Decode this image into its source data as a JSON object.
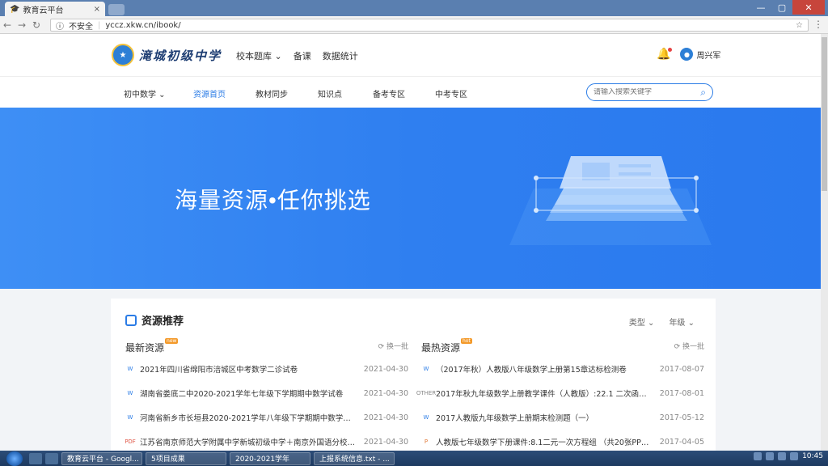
{
  "browser": {
    "tab_title": "教育云平台",
    "tab_close": "×",
    "insecure_label": "不安全",
    "url": "yccz.xkw.cn/ibook/",
    "win_min": "—",
    "win_max": "▢",
    "win_close": "✕"
  },
  "header": {
    "logo_text": "滝城初级中学",
    "nav": [
      "校本题库 ⌄",
      "备课",
      "数据统计"
    ],
    "user_name": "周兴军"
  },
  "subnav": {
    "items": [
      "初中数学 ⌄",
      "资源首页",
      "教材同步",
      "知识点",
      "备考专区",
      "中考专区"
    ],
    "active_index": 1,
    "search_placeholder": "请输入搜索关键字"
  },
  "banner": {
    "slogan": "海量资源•任你挑选"
  },
  "recommend": {
    "title": "资源推荐",
    "filters": [
      "类型 ⌄",
      "年级 ⌄"
    ],
    "latest": {
      "heading": "最新资源",
      "badge": "new",
      "refresh": "换一批",
      "rows": [
        {
          "type": "W",
          "title": "2021年四川省绵阳市涪城区中考数学二诊试卷",
          "date": "2021-04-30"
        },
        {
          "type": "W",
          "title": "湖南省娄底二中2020-2021学年七年级下学期期中数学试卷",
          "date": "2021-04-30"
        },
        {
          "type": "W",
          "title": "河南省新乡市长垣县2020-2021学年八年级下学期期中数学试卷",
          "date": "2021-04-30"
        },
        {
          "type": "PDF",
          "title": "江苏省南京师范大学附属中学新城初级中学＋南京外国语分校202...",
          "date": "2021-04-30"
        }
      ]
    },
    "hottest": {
      "heading": "最热资源",
      "badge": "hot",
      "refresh": "换一批",
      "rows": [
        {
          "type": "W",
          "title": "（2017年秋）人教版八年级数学上册第15章达标检测卷",
          "date": "2017-08-07"
        },
        {
          "type": "OTHER",
          "title": "2017年秋九年级数学上册教学课件（人教版）:22.1 二次函数的图...",
          "date": "2017-08-01"
        },
        {
          "type": "W",
          "title": "2017人教版九年级数学上册期末检测题（一）",
          "date": "2017-05-12"
        },
        {
          "type": "P",
          "title": "人教版七年级数学下册课件:8.1二元一次方程组 （共20张PPT）",
          "date": "2017-04-05"
        }
      ]
    }
  },
  "taskbar": {
    "items": [
      "教育云平台 - Googl...",
      "5项目成果",
      "2020-2021学年",
      "上报系统信息.txt - ..."
    ],
    "clock": "10:45"
  }
}
